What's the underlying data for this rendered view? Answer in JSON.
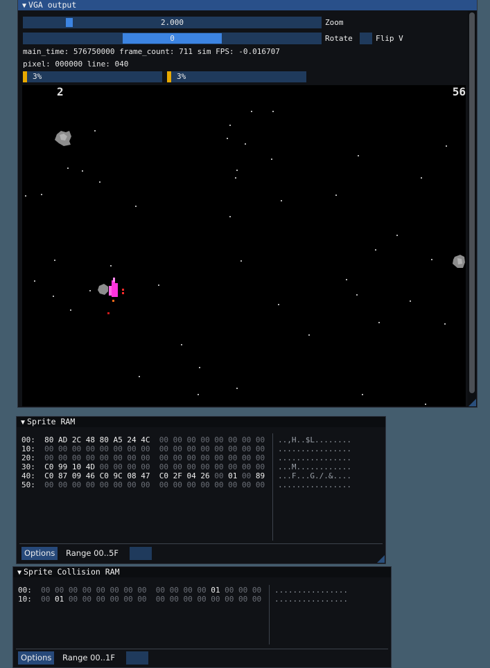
{
  "vga": {
    "title": "VGA output",
    "zoom": {
      "value_text": "2.000",
      "label": "Zoom"
    },
    "rotate": {
      "value_text": "0",
      "label": "Rotate"
    },
    "flip": {
      "label": "Flip V"
    },
    "stats_line1": "main_time: 576750000 frame_count: 711 sim FPS: -0.016707",
    "stats_line2": "pixel: 000000 line: 040",
    "progress": [
      {
        "text": "3%",
        "fraction": 0.03
      },
      {
        "text": "3%",
        "fraction": 0.03
      }
    ],
    "game": {
      "score_left": "2",
      "score_right": "56"
    }
  },
  "sprite_ram": {
    "title": "Sprite RAM",
    "rows": [
      {
        "addr": "00:",
        "bytes": [
          "80",
          "AD",
          "2C",
          "48",
          "80",
          "A5",
          "24",
          "4C",
          "00",
          "00",
          "00",
          "00",
          "00",
          "00",
          "00",
          "00"
        ],
        "ascii": "..,H..$L........"
      },
      {
        "addr": "10:",
        "bytes": [
          "00",
          "00",
          "00",
          "00",
          "00",
          "00",
          "00",
          "00",
          "00",
          "00",
          "00",
          "00",
          "00",
          "00",
          "00",
          "00"
        ],
        "ascii": "................"
      },
      {
        "addr": "20:",
        "bytes": [
          "00",
          "00",
          "00",
          "00",
          "00",
          "00",
          "00",
          "00",
          "00",
          "00",
          "00",
          "00",
          "00",
          "00",
          "00",
          "00"
        ],
        "ascii": "................"
      },
      {
        "addr": "30:",
        "bytes": [
          "C0",
          "99",
          "10",
          "4D",
          "00",
          "00",
          "00",
          "00",
          "00",
          "00",
          "00",
          "00",
          "00",
          "00",
          "00",
          "00"
        ],
        "ascii": "...M............"
      },
      {
        "addr": "40:",
        "bytes": [
          "C0",
          "87",
          "09",
          "46",
          "C0",
          "9C",
          "08",
          "47",
          "C0",
          "2F",
          "04",
          "26",
          "00",
          "01",
          "00",
          "89"
        ],
        "ascii": "...F...G./.&...."
      },
      {
        "addr": "50:",
        "bytes": [
          "00",
          "00",
          "00",
          "00",
          "00",
          "00",
          "00",
          "00",
          "00",
          "00",
          "00",
          "00",
          "00",
          "00",
          "00",
          "00"
        ],
        "ascii": "................"
      }
    ],
    "options_label": "Options",
    "range_label": "Range 00..5F"
  },
  "collision_ram": {
    "title": "Sprite Collision RAM",
    "rows": [
      {
        "addr": "00:",
        "bytes": [
          "00",
          "00",
          "00",
          "00",
          "00",
          "00",
          "00",
          "00",
          "00",
          "00",
          "00",
          "00",
          "01",
          "00",
          "00",
          "00"
        ],
        "ascii": "................"
      },
      {
        "addr": "10:",
        "bytes": [
          "00",
          "01",
          "00",
          "00",
          "00",
          "00",
          "00",
          "00",
          "00",
          "00",
          "00",
          "00",
          "00",
          "00",
          "00",
          "00"
        ],
        "ascii": "................"
      }
    ],
    "options_label": "Options",
    "range_label": "Range 00..1F"
  },
  "colors": {
    "title_active": "#29508a",
    "slider_bg": "#1f3a5c",
    "slider_grab": "#3c84e2",
    "progress_fill": "#e8a900",
    "ship": "#ff33dd"
  }
}
